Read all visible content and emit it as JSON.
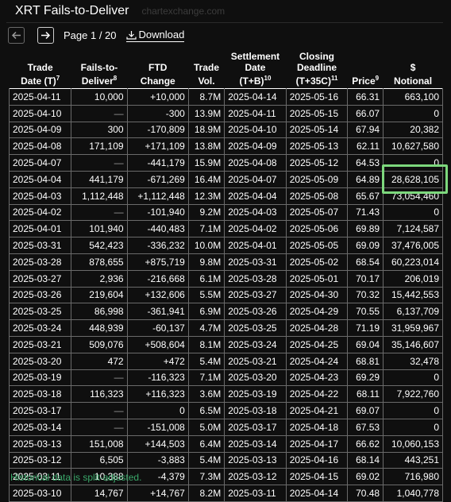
{
  "header": {
    "title": "XRT Fails-to-Deliver",
    "watermark": "chartexchange.com"
  },
  "pager": {
    "page_label": "Page 1 / 20",
    "download_label": "Download"
  },
  "columns": [
    {
      "l1": "Trade",
      "l2": "Date (T)",
      "sup": "7"
    },
    {
      "l1": "Fails-to-",
      "l2": "Deliver",
      "sup": "8"
    },
    {
      "l1": "FTD",
      "l2": "Change",
      "sup": ""
    },
    {
      "l1": "Trade",
      "l2": "Vol.",
      "sup": ""
    },
    {
      "l0": "Settlement",
      "l1": "Date",
      "l2": "(T+B)",
      "sup": "10"
    },
    {
      "l0": "Closing",
      "l1": "Deadline",
      "l2": "(T+35C)",
      "sup": "11"
    },
    {
      "l1": "",
      "l2": "Price",
      "sup": "9"
    },
    {
      "l1": "$",
      "l2": "Notional",
      "sup": ""
    }
  ],
  "rows": [
    [
      "2025-04-11",
      "10,000",
      "+10,000",
      "8.7M",
      "2025-04-14",
      "2025-05-16",
      "66.31",
      "663,100"
    ],
    [
      "2025-04-10",
      "—",
      "-300",
      "13.9M",
      "2025-04-11",
      "2025-05-15",
      "66.07",
      "0"
    ],
    [
      "2025-04-09",
      "300",
      "-170,809",
      "18.9M",
      "2025-04-10",
      "2025-05-14",
      "67.94",
      "20,382"
    ],
    [
      "2025-04-08",
      "171,109",
      "+171,109",
      "13.8M",
      "2025-04-09",
      "2025-05-13",
      "62.11",
      "10,627,580"
    ],
    [
      "2025-04-07",
      "—",
      "-441,179",
      "15.9M",
      "2025-04-08",
      "2025-05-12",
      "64.53",
      "0"
    ],
    [
      "2025-04-04",
      "441,179",
      "-671,269",
      "16.4M",
      "2025-04-07",
      "2025-05-09",
      "64.89",
      "28,628,105"
    ],
    [
      "2025-04-03",
      "1,112,448",
      "+1,112,448",
      "12.3M",
      "2025-04-04",
      "2025-05-08",
      "65.67",
      "73,054,460"
    ],
    [
      "2025-04-02",
      "—",
      "-101,940",
      "9.2M",
      "2025-04-03",
      "2025-05-07",
      "71.43",
      "0"
    ],
    [
      "2025-04-01",
      "101,940",
      "-440,483",
      "7.1M",
      "2025-04-02",
      "2025-05-06",
      "69.89",
      "7,124,587"
    ],
    [
      "2025-03-31",
      "542,423",
      "-336,232",
      "10.0M",
      "2025-04-01",
      "2025-05-05",
      "69.09",
      "37,476,005"
    ],
    [
      "2025-03-28",
      "878,655",
      "+875,719",
      "9.8M",
      "2025-03-31",
      "2025-05-02",
      "68.54",
      "60,223,014"
    ],
    [
      "2025-03-27",
      "2,936",
      "-216,668",
      "6.1M",
      "2025-03-28",
      "2025-05-01",
      "70.17",
      "206,019"
    ],
    [
      "2025-03-26",
      "219,604",
      "+132,606",
      "5.5M",
      "2025-03-27",
      "2025-04-30",
      "70.32",
      "15,442,553"
    ],
    [
      "2025-03-25",
      "86,998",
      "-361,941",
      "6.9M",
      "2025-03-26",
      "2025-04-29",
      "70.55",
      "6,137,709"
    ],
    [
      "2025-03-24",
      "448,939",
      "-60,137",
      "4.7M",
      "2025-03-25",
      "2025-04-28",
      "71.19",
      "31,959,967"
    ],
    [
      "2025-03-21",
      "509,076",
      "+508,604",
      "8.1M",
      "2025-03-24",
      "2025-04-25",
      "69.04",
      "35,146,607"
    ],
    [
      "2025-03-20",
      "472",
      "+472",
      "5.4M",
      "2025-03-21",
      "2025-04-24",
      "68.81",
      "32,478"
    ],
    [
      "2025-03-19",
      "—",
      "-116,323",
      "7.1M",
      "2025-03-20",
      "2025-04-23",
      "69.29",
      "0"
    ],
    [
      "2025-03-18",
      "116,323",
      "+116,323",
      "3.6M",
      "2025-03-19",
      "2025-04-22",
      "68.11",
      "7,922,760"
    ],
    [
      "2025-03-17",
      "—",
      "0",
      "6.5M",
      "2025-03-18",
      "2025-04-21",
      "69.07",
      "0"
    ],
    [
      "2025-03-14",
      "—",
      "-151,008",
      "5.0M",
      "2025-03-17",
      "2025-04-18",
      "67.53",
      "0"
    ],
    [
      "2025-03-13",
      "151,008",
      "+144,503",
      "6.4M",
      "2025-03-14",
      "2025-04-17",
      "66.62",
      "10,060,153"
    ],
    [
      "2025-03-12",
      "6,505",
      "-3,883",
      "5.4M",
      "2025-03-13",
      "2025-04-16",
      "68.14",
      "443,251"
    ],
    [
      "2025-03-11",
      "10,388",
      "-4,379",
      "7.3M",
      "2025-03-12",
      "2025-04-15",
      "69.02",
      "716,980"
    ],
    [
      "2025-03-10",
      "14,767",
      "+14,767",
      "8.2M",
      "2025-03-11",
      "2025-04-14",
      "70.48",
      "1,040,778"
    ]
  ],
  "footnote": "Historical data is split-adjusted.",
  "colors": {
    "background": "#0f0f0f",
    "highlight": "#7dd87d",
    "footnote": "#3aa86a"
  }
}
